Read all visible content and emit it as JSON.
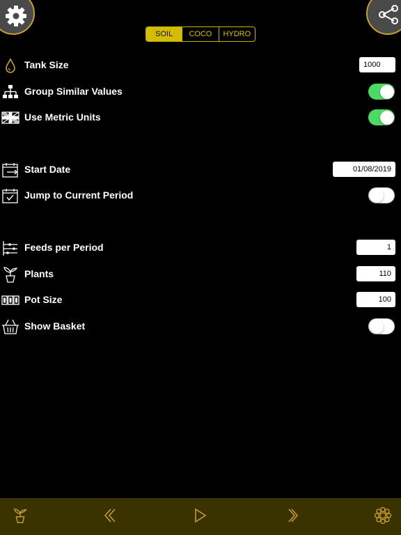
{
  "header": {
    "settings_icon": "gear-icon",
    "share_icon": "share-icon",
    "tabs": [
      {
        "label": "SOIL",
        "active": true
      },
      {
        "label": "COCO",
        "active": false
      },
      {
        "label": "HYDRO",
        "active": false
      }
    ]
  },
  "settings": {
    "tank_size": {
      "label": "Tank Size",
      "value": "1000",
      "icon": "water-drop-icon"
    },
    "group_similar": {
      "label": "Group Similar Values",
      "on": true,
      "icon": "hierarchy-icon"
    },
    "metric_units": {
      "label": "Use Metric Units",
      "on": true,
      "icon": "uk-flag-icon"
    },
    "start_date": {
      "label": "Start Date",
      "value": "01/08/2019",
      "icon": "calendar-arrow-icon"
    },
    "jump_current": {
      "label": "Jump to Current Period",
      "on": false,
      "icon": "calendar-check-icon"
    },
    "feeds_per_period": {
      "label": "Feeds per Period",
      "value": "1",
      "icon": "timeline-icon"
    },
    "plants": {
      "label": "Plants",
      "value": "110",
      "icon": "potted-plant-icon"
    },
    "pot_size": {
      "label": "Pot Size",
      "value": "100",
      "icon": "counter-icon"
    },
    "show_basket": {
      "label": "Show Basket",
      "on": false,
      "icon": "basket-icon"
    }
  },
  "bottom_bar": {
    "items": [
      "plant-icon",
      "double-chevron-left-icon",
      "play-icon",
      "chevron-right-icon",
      "flower-icon"
    ]
  },
  "colors": {
    "accent": "#d4bc00",
    "toggle_on": "#4cd964",
    "bottom_bar": "#3a3300"
  }
}
